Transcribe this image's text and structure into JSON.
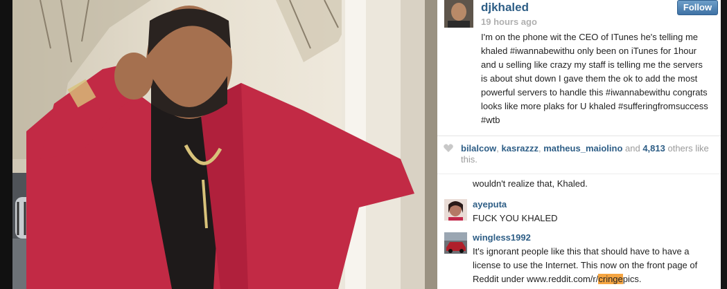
{
  "post": {
    "username": "djkhaled",
    "follow_label": "Follow",
    "time": "19 hours ago",
    "caption": "I'm on the phone wit the CEO of ITunes he's telling me khaled #iwannabewithu only been on iTunes for 1hour and u selling like crazy my staff is telling me the servers is about shut down I gave them the ok to add the most powerful servers to handle this #iwannabewithu congrats looks like more plaks for U khaled #sufferingfromsuccess #wtb"
  },
  "likes": {
    "user1": "bilalcow",
    "sep1": ", ",
    "user2": "kasrazzz",
    "sep2": ", ",
    "user3": "matheus_maiolino",
    "and": " and ",
    "count": "4,813",
    "suffix": " others like this."
  },
  "comments": {
    "previous_text": "wouldn't realize that, Khaled.",
    "items": [
      {
        "user": "ayeputa",
        "text": "FUCK YOU KHALED"
      },
      {
        "user": "wingless1992",
        "text_before": "It's ignorant people like this that should have to have a license to use the Internet. This now on the front page of Reddit under www.reddit.com/r/",
        "highlight": "cringe",
        "text_after": "pics."
      }
    ]
  },
  "colors": {
    "link": "#2e5e86",
    "follow_button": "#4a7db0",
    "highlight": "#f5a542"
  },
  "icons": {
    "like": "heart-icon"
  }
}
